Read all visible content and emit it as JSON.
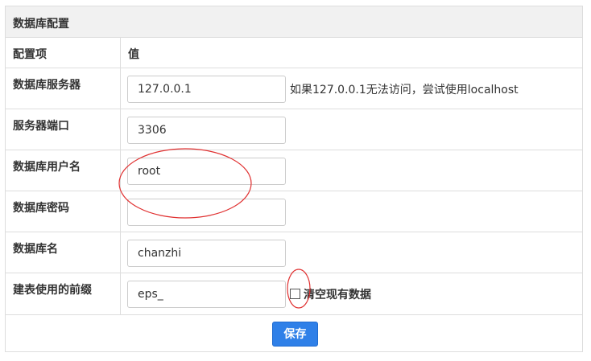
{
  "panel": {
    "title": "数据库配置"
  },
  "table": {
    "header": {
      "item": "配置项",
      "value": "值"
    },
    "rows": [
      {
        "label": "数据库服务器",
        "value": "127.0.0.1",
        "hint": "如果127.0.0.1无法访问，尝试使用localhost"
      },
      {
        "label": "服务器端口",
        "value": "3306"
      },
      {
        "label": "数据库用户名",
        "value": "root"
      },
      {
        "label": "数据库密码",
        "value": ""
      },
      {
        "label": "数据库名",
        "value": "chanzhi"
      },
      {
        "label": "建表使用的前缀",
        "value": "eps_",
        "checkbox_label": "清空现有数据",
        "checkbox_checked": false
      }
    ]
  },
  "actions": {
    "save_label": "保存"
  },
  "colors": {
    "accent": "#2f80e8",
    "annotation": "#e03030",
    "header_bg": "#f1f1f1",
    "border": "#dddddd"
  }
}
